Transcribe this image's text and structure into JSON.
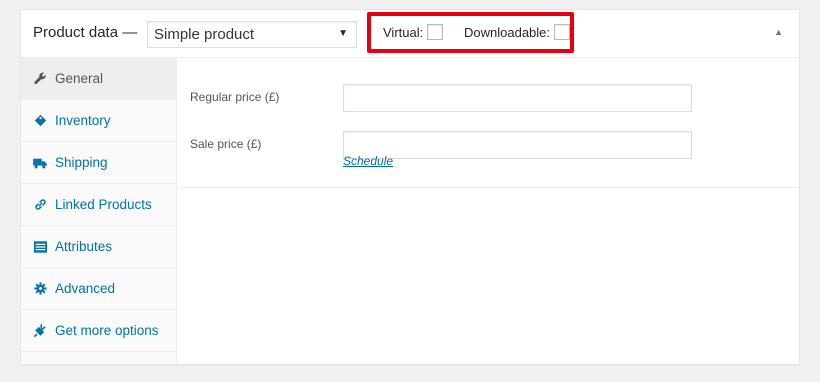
{
  "header": {
    "title": "Product data —",
    "product_type": "Simple product",
    "virtual_label": "Virtual:",
    "downloadable_label": "Downloadable:"
  },
  "tabs": [
    {
      "label": "General",
      "icon": "wrench-icon",
      "active": true
    },
    {
      "label": "Inventory",
      "icon": "tag-icon"
    },
    {
      "label": "Shipping",
      "icon": "truck-icon"
    },
    {
      "label": "Linked Products",
      "icon": "link-icon"
    },
    {
      "label": "Attributes",
      "icon": "list-icon"
    },
    {
      "label": "Advanced",
      "icon": "gear-icon"
    },
    {
      "label": "Get more options",
      "icon": "plugin-icon"
    }
  ],
  "fields": {
    "regular_price_label": "Regular price (£)",
    "regular_price_value": "",
    "sale_price_label": "Sale price (£)",
    "sale_price_value": "",
    "schedule_link": "Schedule"
  },
  "colors": {
    "accent": "#0073aa",
    "highlight": "#e6000f"
  }
}
